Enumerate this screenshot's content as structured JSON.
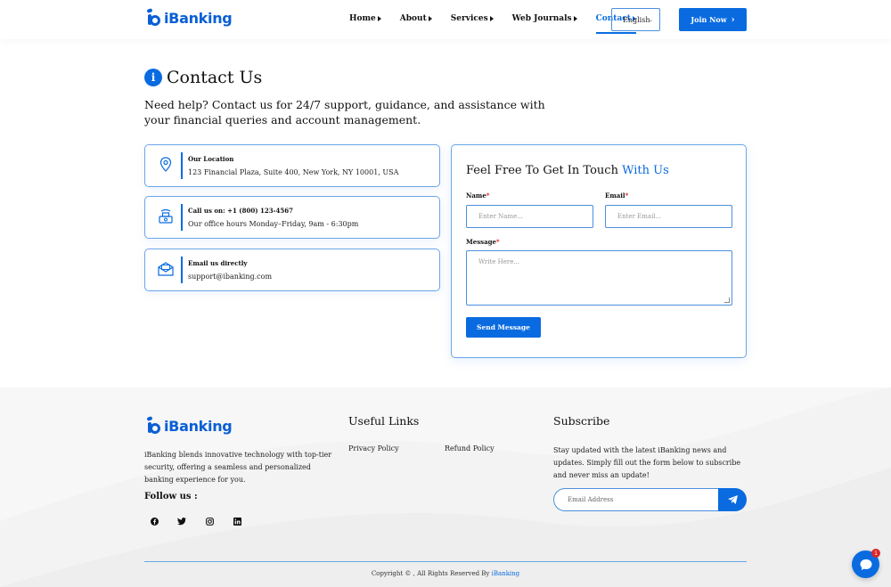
{
  "brand": {
    "name": "iBanking",
    "accent": "#0a6be0"
  },
  "nav": {
    "items": [
      {
        "label": "Home",
        "active": false
      },
      {
        "label": "About",
        "active": false
      },
      {
        "label": "Services",
        "active": false
      },
      {
        "label": "Web Journals",
        "active": false
      },
      {
        "label": "Contact",
        "active": true
      }
    ],
    "language": "English",
    "join_label": "Join Now"
  },
  "main": {
    "title": "Contact Us",
    "subtitle": "Need help? Contact us for 24/7 support, guidance, and assistance with your financial queries and account management.",
    "cards": [
      {
        "icon": "location-pin-icon",
        "label": "Our Location",
        "value": "123 Financial Plaza, Suite 400, New York, NY 10001, USA"
      },
      {
        "icon": "phone-icon",
        "label": "Call us on: +1 (800) 123-4567",
        "value": "Our office hours Monday–Friday, 9am - 6:30pm"
      },
      {
        "icon": "envelope-icon",
        "label": "Email us directly",
        "value": "support@ibanking.com"
      }
    ]
  },
  "form": {
    "title_part1": "Feel Free To Get In Touch ",
    "title_part2": "With Us",
    "name_label": "Name",
    "name_placeholder": "Enter Name...",
    "email_label": "Email",
    "email_placeholder": "Enter Email...",
    "message_label": "Message",
    "message_placeholder": "Write Here...",
    "required_mark": "*",
    "send_label": "Send Message"
  },
  "footer": {
    "description": "iBanking blends innovative technology with top-tier security, offering a seamless and personalized banking experience for you.",
    "follow_label": "Follow us :",
    "socials": [
      "facebook-icon",
      "twitter-icon",
      "instagram-icon",
      "linkedin-icon"
    ],
    "useful_links_title": "Useful Links",
    "links": [
      "Privacy Policy",
      "Refund Policy"
    ],
    "subscribe_title": "Subscribe",
    "subscribe_text": "Stay updated with the latest iBanking news and updates. Simply fill out the form below to subscribe and never miss an update!",
    "email_placeholder": "Email Address",
    "copyright_prefix": "Copyright © , All Rights Reserved By ",
    "copyright_brand": "iBanking"
  },
  "chat": {
    "badge": "1"
  }
}
